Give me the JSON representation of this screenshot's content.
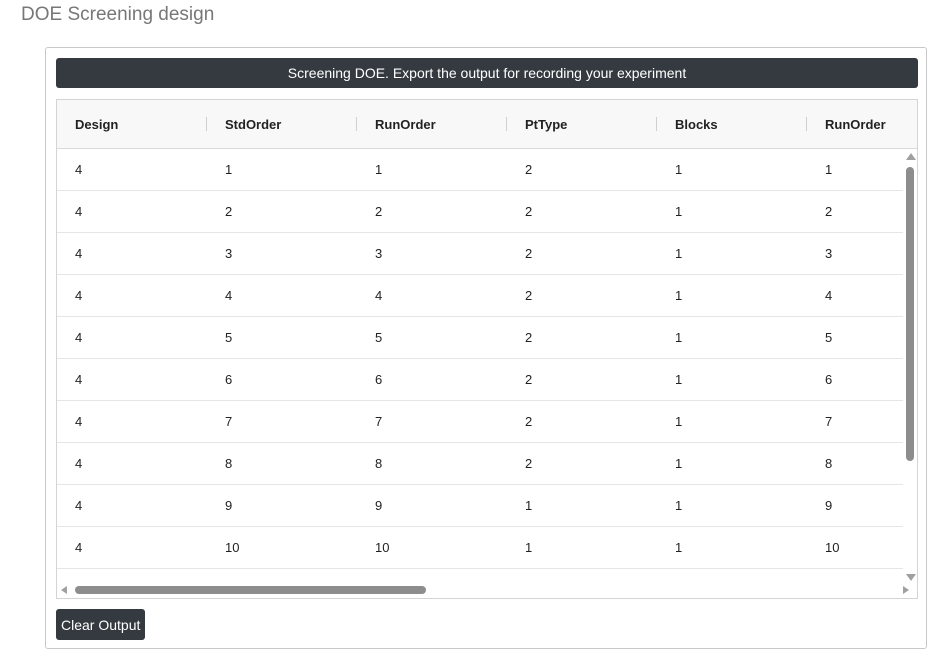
{
  "page": {
    "title": "DOE Screening design"
  },
  "panel": {
    "banner": "Screening DOE. Export the output for recording your experiment",
    "clear_button": "Clear Output"
  },
  "table": {
    "columns": [
      "Design",
      "StdOrder",
      "RunOrder",
      "PtType",
      "Blocks",
      "RunOrder"
    ],
    "rows": [
      [
        "4",
        "1",
        "1",
        "2",
        "1",
        "1"
      ],
      [
        "4",
        "2",
        "2",
        "2",
        "1",
        "2"
      ],
      [
        "4",
        "3",
        "3",
        "2",
        "1",
        "3"
      ],
      [
        "4",
        "4",
        "4",
        "2",
        "1",
        "4"
      ],
      [
        "4",
        "5",
        "5",
        "2",
        "1",
        "5"
      ],
      [
        "4",
        "6",
        "6",
        "2",
        "1",
        "6"
      ],
      [
        "4",
        "7",
        "7",
        "2",
        "1",
        "7"
      ],
      [
        "4",
        "8",
        "8",
        "2",
        "1",
        "8"
      ],
      [
        "4",
        "9",
        "9",
        "1",
        "1",
        "9"
      ],
      [
        "4",
        "10",
        "10",
        "1",
        "1",
        "10"
      ]
    ]
  },
  "colors": {
    "dark": "#343a40",
    "header_bg": "#f8f8f8"
  }
}
